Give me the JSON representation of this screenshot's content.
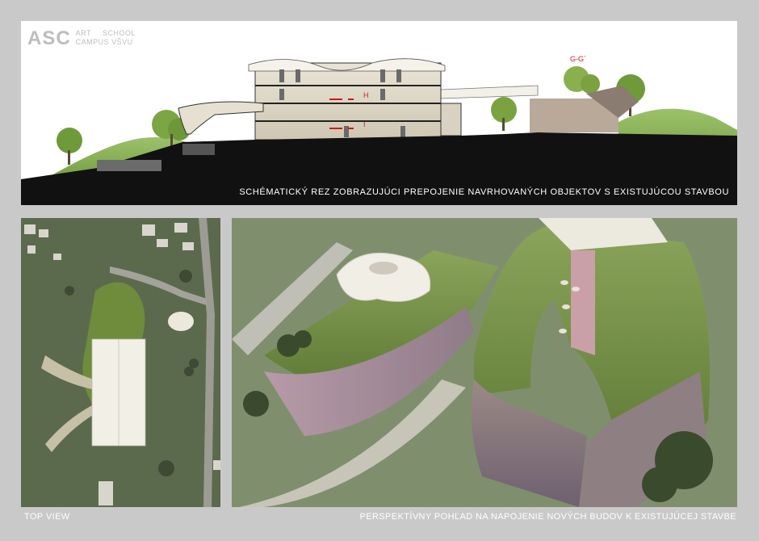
{
  "logo": {
    "mark": "ASC",
    "line1a": "ART",
    "line1b": "SCHOOL",
    "line2": "CAMPUS VŠVU"
  },
  "section": {
    "caption": "SCHÉMATICKÝ REZ ZOBRAZUJÚCI PREPOJENIE NAVRHOVANÝCH OBJEKTOV S EXISTUJÚCOU STAVBOU",
    "gg_label": "G-G´",
    "markers": [
      "H",
      "I",
      "J"
    ]
  },
  "captions": {
    "left": "TOP VIEW",
    "right": "PERSPEKTÍVNY POHĽAD NA NAPOJENIE NOVÝCH BUDOV K EXISTUJÚCEJ STAVBE"
  },
  "colors": {
    "board": "#c9c9c9",
    "ground": "#111111",
    "grass": "#7a9a4a",
    "marker": "#d01818"
  }
}
